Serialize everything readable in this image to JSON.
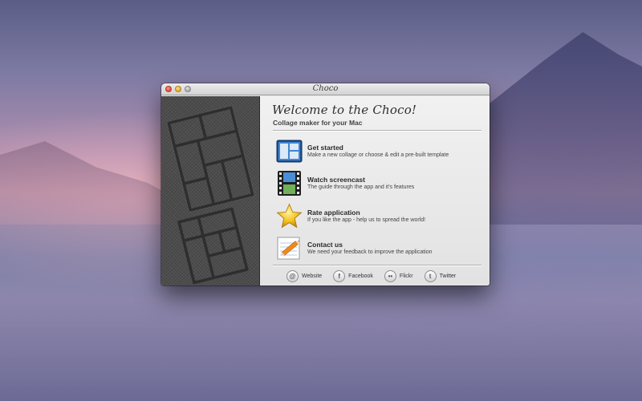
{
  "window": {
    "title": "Choco"
  },
  "welcome": {
    "heading": "Welcome to the Choco!",
    "subtitle": "Collage maker for your Mac"
  },
  "actions": [
    {
      "label": "Get started",
      "description": "Make a new collage or choose & edit  a pre-built template",
      "icon": "layout-grid-icon"
    },
    {
      "label": "Watch screencast",
      "description": "The guide through the app and it's features",
      "icon": "film-strip-icon"
    },
    {
      "label": "Rate application",
      "description": "If you like the app - help us to spread the world!",
      "icon": "star-icon"
    },
    {
      "label": "Contact us",
      "description": "We need your feedback to improve the application",
      "icon": "pencil-paper-icon"
    }
  ],
  "footer": [
    {
      "label": "Website",
      "icon": "globe-icon",
      "glyph": "@"
    },
    {
      "label": "Facebook",
      "icon": "facebook-icon",
      "glyph": "f"
    },
    {
      "label": "Flickr",
      "icon": "flickr-icon",
      "glyph": "••"
    },
    {
      "label": "Twitter",
      "icon": "twitter-icon",
      "glyph": "t"
    }
  ],
  "colors": {
    "accent_blue": "#2f6fb8",
    "star": "#f3c21b",
    "panel_dark": "#4c4c4c"
  }
}
